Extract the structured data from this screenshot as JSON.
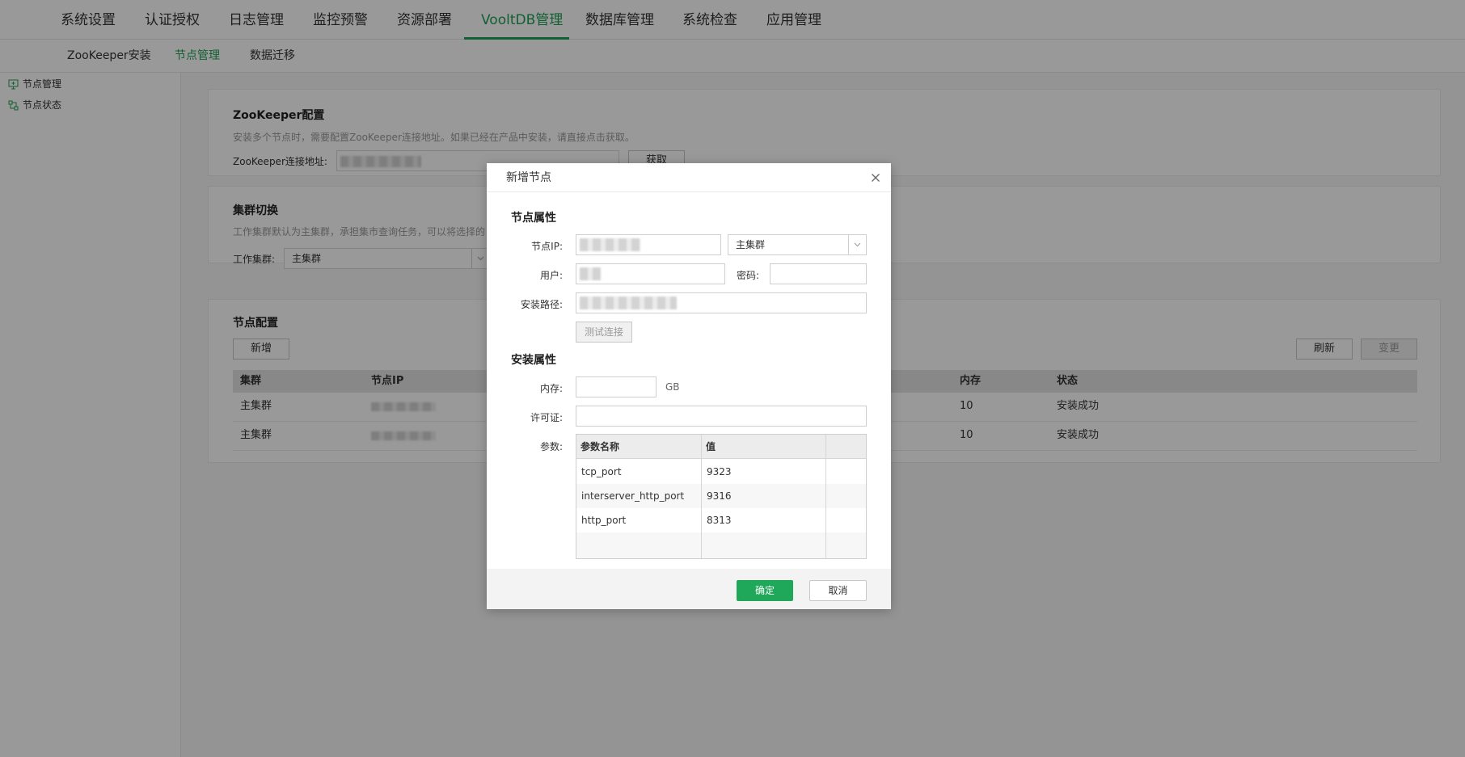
{
  "topnav": {
    "items": [
      "系统设置",
      "认证授权",
      "日志管理",
      "监控预警",
      "资源部署",
      "VooltDB管理",
      "数据库管理",
      "系统检查",
      "应用管理"
    ],
    "active_index": 5
  },
  "subnav": {
    "items": [
      "ZooKeeper安装",
      "节点管理",
      "数据迁移"
    ],
    "active_index": 1
  },
  "sidebar": {
    "items": [
      {
        "label": "节点管理",
        "icon": "monitor-icon"
      },
      {
        "label": "节点状态",
        "icon": "tree-icon"
      }
    ]
  },
  "zk_card": {
    "title": "ZooKeeper配置",
    "desc": "安装多个节点时，需要配置ZooKeeper连接地址。如果已经在产品中安装，请直接点击获取。",
    "field_label": "ZooKeeper连接地址:",
    "button": "获取"
  },
  "cluster_card": {
    "title": "集群切换",
    "desc": "工作集群默认为主集群，承担集市查询任务，可以将选择的",
    "field_label": "工作集群:",
    "value": "主集群"
  },
  "node_card": {
    "title": "节点配置",
    "add_button": "新增",
    "refresh_button": "刷新",
    "change_button": "变更",
    "columns": [
      "集群",
      "节点IP",
      "内存",
      "状态"
    ],
    "rows": [
      {
        "cluster": "主集群",
        "memory": "10",
        "status": "安装成功"
      },
      {
        "cluster": "主集群",
        "memory": "10",
        "status": "安装成功"
      }
    ]
  },
  "modal": {
    "title": "新增节点",
    "section_node": "节点属性",
    "ip_label": "节点IP:",
    "cluster_value": "主集群",
    "user_label": "用户:",
    "password_label": "密码:",
    "path_label": "安装路径:",
    "test_button": "测试连接",
    "section_install": "安装属性",
    "memory_label": "内存:",
    "memory_unit": "GB",
    "license_label": "许可证:",
    "params_label": "参数:",
    "params_columns": [
      "参数名称",
      "值"
    ],
    "params": [
      {
        "name": "tcp_port",
        "value": "9323"
      },
      {
        "name": "interserver_http_port",
        "value": "9316"
      },
      {
        "name": "http_port",
        "value": "8313"
      }
    ],
    "ok_button": "确定",
    "cancel_button": "取消"
  },
  "colors": {
    "accent": "#1f9e56",
    "ok_button": "#1fa85a"
  }
}
